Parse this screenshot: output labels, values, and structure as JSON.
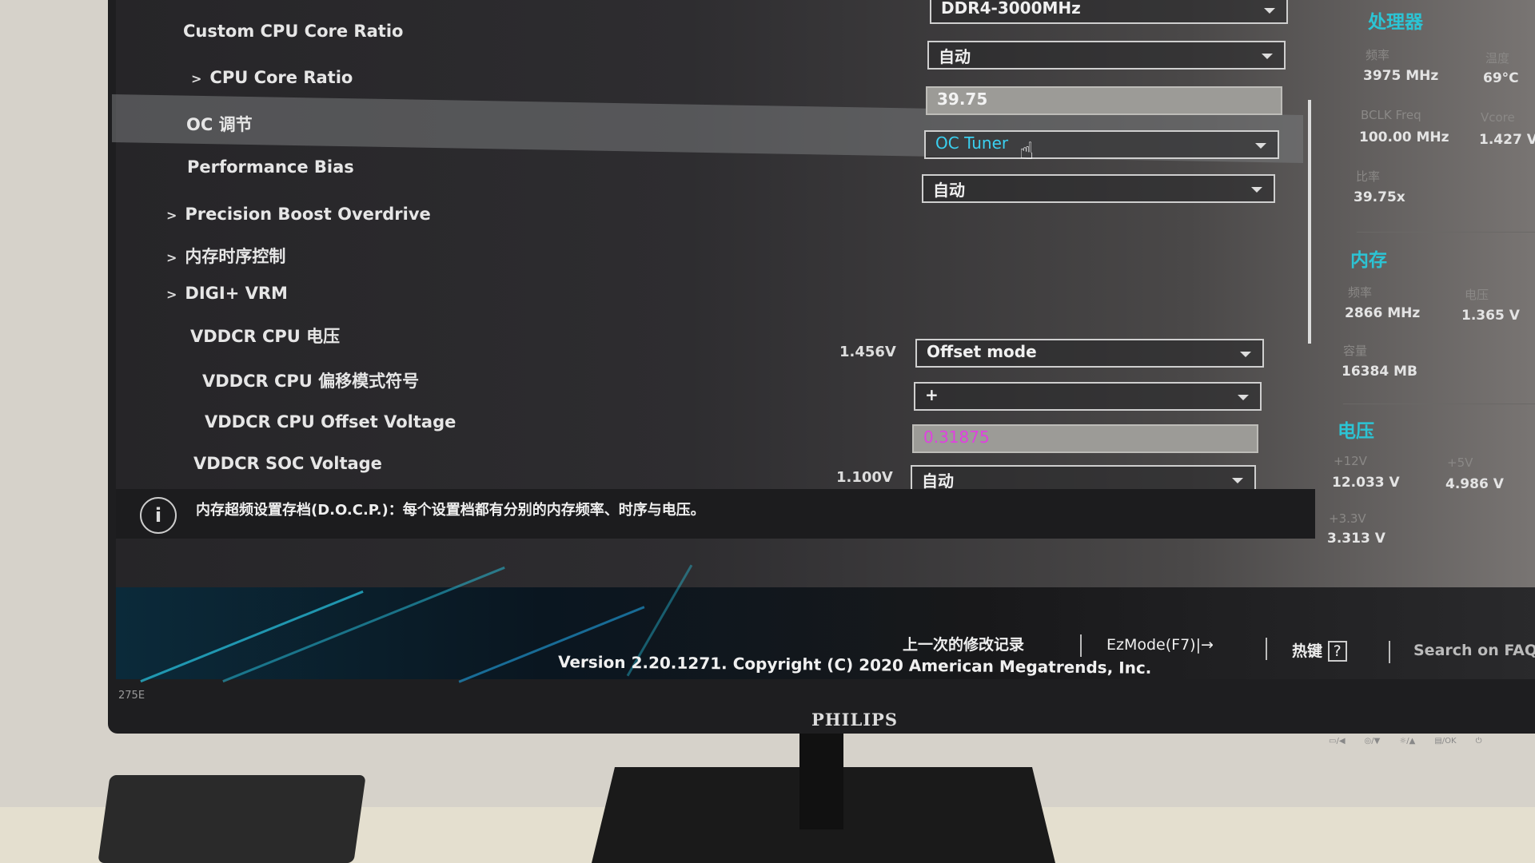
{
  "settings": [
    {
      "label": "Custom CPU Core Ratio",
      "prefix": "",
      "value": "自动",
      "control": "dropdown"
    },
    {
      "label": "CPU Core Ratio",
      "prefix": ">",
      "value": "39.75",
      "control": "field"
    },
    {
      "label": "OC 调节",
      "prefix": "",
      "value": "OC Tuner",
      "control": "dropdown",
      "selected": true
    },
    {
      "label": "Performance Bias",
      "prefix": "",
      "value": "自动",
      "control": "dropdown"
    },
    {
      "label": "Precision Boost Overdrive",
      "prefix": ">",
      "control": "submenu"
    },
    {
      "label": "内存时序控制",
      "prefix": ">",
      "control": "submenu"
    },
    {
      "label": "DIGI+ VRM",
      "prefix": ">",
      "control": "submenu"
    },
    {
      "label": "VDDCR CPU 电压",
      "reading": "1.456V",
      "value": "Offset mode",
      "control": "dropdown"
    },
    {
      "label": "VDDCR CPU 偏移模式符号",
      "value": "+",
      "control": "dropdown"
    },
    {
      "label": "VDDCR CPU Offset Voltage",
      "value": "0.31875",
      "control": "field"
    },
    {
      "label": "VDDCR SOC Voltage",
      "reading": "1.100V",
      "value": "自动",
      "control": "dropdown"
    }
  ],
  "top_dropdown": "DDR4-3000MHz",
  "info_text": "内存超频设置存档(D.O.C.P.)：每个设置档都有分别的内存频率、时序与电压。",
  "footer": {
    "last_modified": "上一次的修改记录",
    "ezmode": "EzMode(F7)|→",
    "hotkeys": "热键",
    "hotkeys_icon": "?",
    "search": "Search on FAQ",
    "version": "Version 2.20.1271. Copyright (C) 2020 American Megatrends, Inc."
  },
  "hw_monitor": {
    "cpu": {
      "title": "处理器",
      "freq_label": "频率",
      "freq": "3975 MHz",
      "temp_label": "温度",
      "temp": "69°C",
      "bclk_label": "BCLK Freq",
      "bclk": "100.00 MHz",
      "vcore_label": "Vcore",
      "vcore": "1.427 V",
      "ratio_label": "比率",
      "ratio": "39.75x"
    },
    "memory": {
      "title": "内存",
      "freq_label": "频率",
      "freq": "2866 MHz",
      "volt_label": "电压",
      "volt": "1.365 V",
      "cap_label": "容量",
      "cap": "16384 MB"
    },
    "voltage": {
      "title": "电压",
      "v12_label": "+12V",
      "v12": "12.033 V",
      "v5_label": "+5V",
      "v5": "4.986 V",
      "v33_label": "+3.3V",
      "v33": "3.313 V"
    }
  },
  "monitor": {
    "model": "275E",
    "brand": "PHILIPS",
    "buttons": [
      "▭/◀",
      "◎/▼",
      "☼/▲",
      "▤/OK",
      "⏻"
    ]
  },
  "colors": {
    "accent": "#2cc4d4",
    "offset_value": "#e040e0",
    "oc_tuner": "#3ad0f0"
  }
}
